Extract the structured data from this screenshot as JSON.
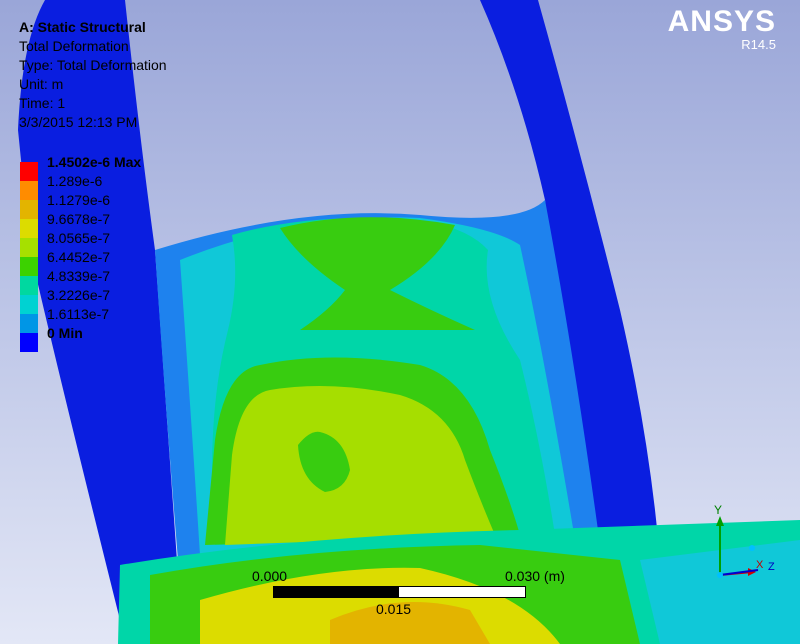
{
  "header": {
    "title": "A: Static Structural",
    "result_name": "Total Deformation",
    "type": "Type: Total Deformation",
    "unit": "Unit: m",
    "time": "Time: 1",
    "date": "3/3/2015 12:13 PM"
  },
  "brand": {
    "name": "ANSYS",
    "version": "R14.5"
  },
  "legend": {
    "levels": [
      {
        "label": "1.4502e-6 Max",
        "color": "#ff0000"
      },
      {
        "label": "1.289e-6",
        "color": "#ff8c00"
      },
      {
        "label": "1.1279e-6",
        "color": "#e3b400"
      },
      {
        "label": "9.6678e-7",
        "color": "#dcdc00"
      },
      {
        "label": "8.0565e-7",
        "color": "#a6e000"
      },
      {
        "label": "6.4452e-7",
        "color": "#3cd200"
      },
      {
        "label": "4.8339e-7",
        "color": "#00d8a0"
      },
      {
        "label": "3.2226e-7",
        "color": "#00d2d2"
      },
      {
        "label": "1.6113e-7",
        "color": "#0096e6"
      },
      {
        "label": "0 Min",
        "color": "#0000ff"
      }
    ]
  },
  "scale_bar": {
    "start_label": "0.000",
    "mid_label": "0.015",
    "end_label": "0.030 (m)"
  },
  "triad": {
    "x": "X",
    "y": "Y",
    "z": "Z"
  }
}
